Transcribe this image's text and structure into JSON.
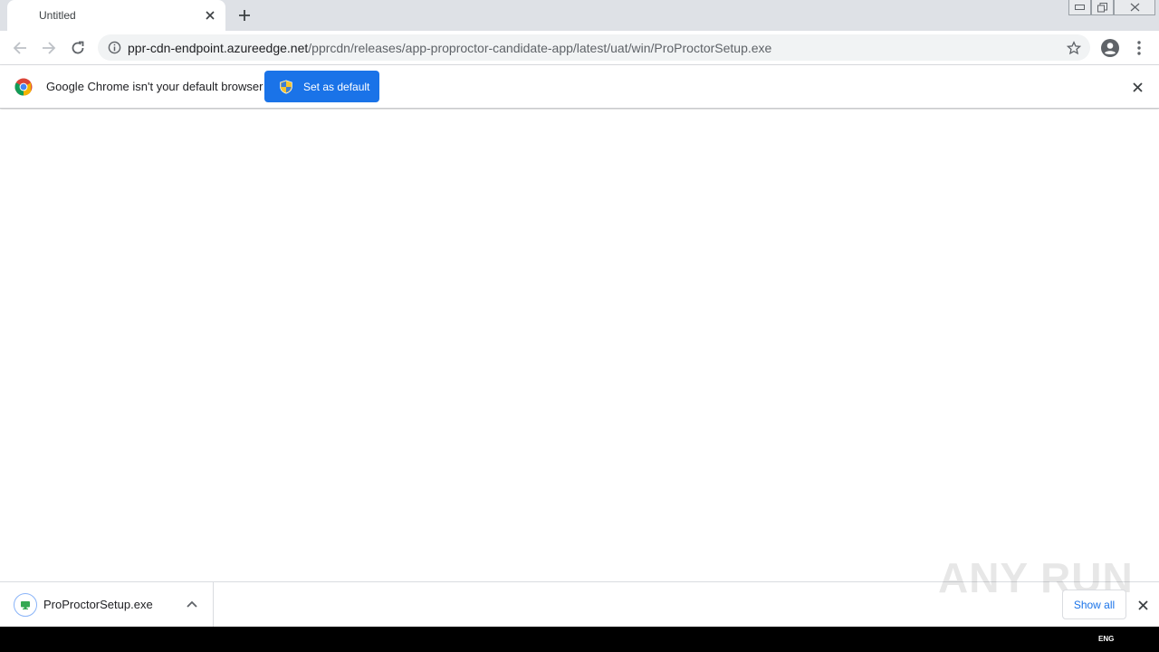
{
  "tab": {
    "title": "Untitled"
  },
  "address": {
    "host": "ppr-cdn-endpoint.azureedge.net",
    "path": "/pprcdn/releases/app-proproctor-candidate-app/latest/uat/win/ProProctorSetup.exe"
  },
  "infobar": {
    "message": "Google Chrome isn't your default browser",
    "button_label": "Set as default"
  },
  "download": {
    "filename": "ProProctorSetup.exe",
    "show_all_label": "Show all"
  },
  "watermark": {
    "text": "ANY RUN"
  },
  "taskbar": {
    "language": "ENG"
  },
  "colors": {
    "accent": "#1a73e8",
    "tabstrip": "#dee1e6",
    "omnibox": "#f1f3f4"
  }
}
